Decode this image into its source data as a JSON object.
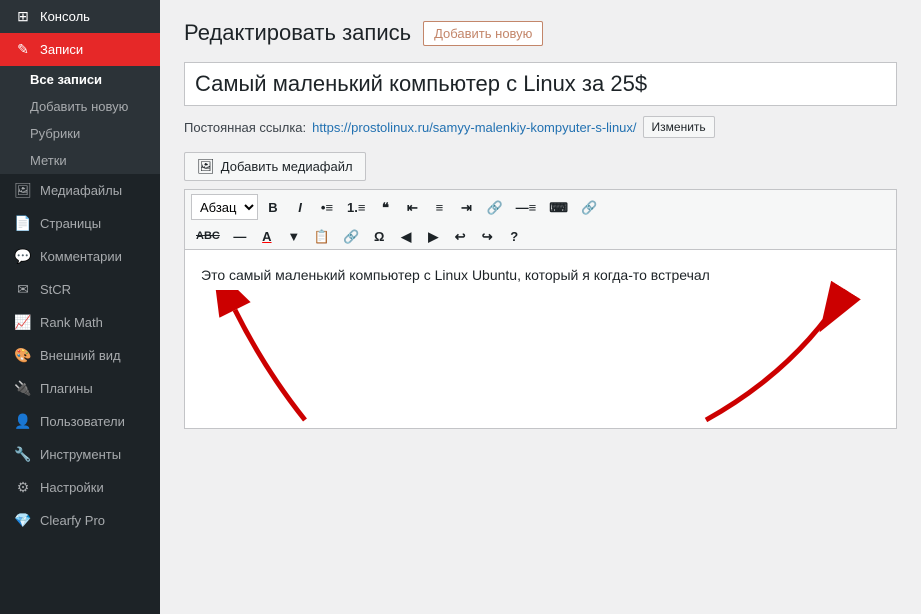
{
  "sidebar": {
    "items": [
      {
        "id": "konsol",
        "label": "Консоль",
        "icon": "⊞",
        "active": false
      },
      {
        "id": "zapisi",
        "label": "Записи",
        "icon": "✎",
        "active": true
      },
      {
        "id": "mediafaily",
        "label": "Медиафайлы",
        "icon": "🖼",
        "active": false
      },
      {
        "id": "stranicy",
        "label": "Страницы",
        "icon": "📄",
        "active": false
      },
      {
        "id": "kommentarii",
        "label": "Комментарии",
        "icon": "💬",
        "active": false
      },
      {
        "id": "stcr",
        "label": "StCR",
        "icon": "✉",
        "active": false
      },
      {
        "id": "rankmath",
        "label": "Rank Math",
        "icon": "📈",
        "active": false
      },
      {
        "id": "vneshniy",
        "label": "Внешний вид",
        "icon": "🎨",
        "active": false
      },
      {
        "id": "plaginy",
        "label": "Плагины",
        "icon": "🔌",
        "active": false
      },
      {
        "id": "polzovateli",
        "label": "Пользователи",
        "icon": "👤",
        "active": false
      },
      {
        "id": "instrumenty",
        "label": "Инструменты",
        "icon": "🔧",
        "active": false
      },
      {
        "id": "nastroyki",
        "label": "Настройки",
        "icon": "⚙",
        "active": false
      },
      {
        "id": "clearfypro",
        "label": "Clearfy Pro",
        "icon": "💎",
        "active": false
      }
    ],
    "submenu_zapisi": [
      {
        "id": "vse-zapisi",
        "label": "Все записи",
        "active": true
      },
      {
        "id": "dobavit",
        "label": "Добавить новую",
        "active": false
      },
      {
        "id": "rubriki",
        "label": "Рубрики",
        "active": false
      },
      {
        "id": "metki",
        "label": "Метки",
        "active": false
      }
    ]
  },
  "page": {
    "title": "Редактировать запись",
    "add_new_btn": "Добавить новую",
    "post_title": "Самый маленький компьютер с Linux за 25$",
    "permalink_label": "Постоянная ссылка:",
    "permalink_url": "https://prostolinux.ru/samyy-malenkiy-kompyuter-s-linux/",
    "change_btn": "Изменить",
    "add_media_btn": "Добавить медиафайл",
    "editor_content": "Это самый маленький компьютер с Linux Ubuntu, который я когда-то встречал"
  },
  "toolbar": {
    "paragraph_select": "Абзац",
    "buttons_row1": [
      "B",
      "I",
      "≡",
      "≡",
      "❝",
      "≡",
      "≡",
      "≡",
      "🔗",
      "≡",
      "⌨",
      "🔗"
    ],
    "buttons_row2": [
      "ABC",
      "—",
      "A",
      "▼",
      "📋",
      "🔗",
      "Ω",
      "◀",
      "▶",
      "↩",
      "↪",
      "?"
    ]
  }
}
